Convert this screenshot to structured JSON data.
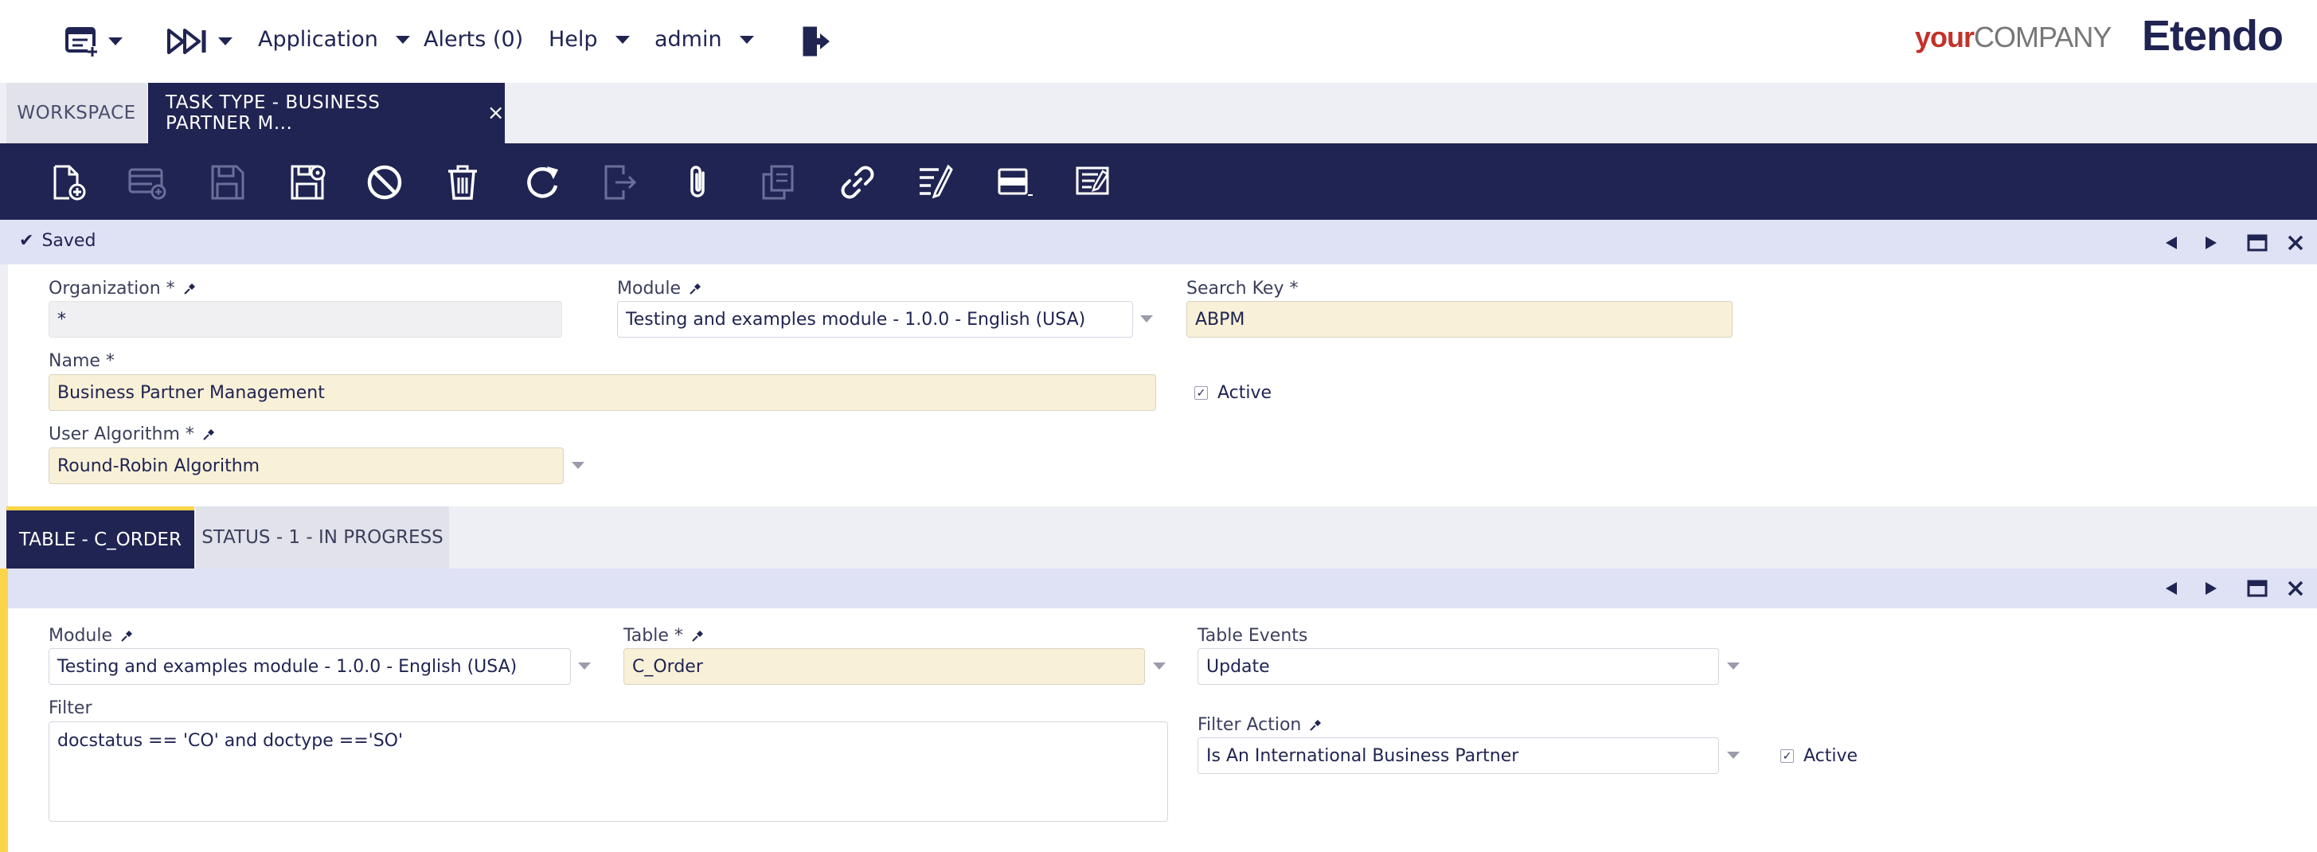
{
  "nav": {
    "application": "Application",
    "alerts": "Alerts (0)",
    "help": "Help",
    "user": "admin"
  },
  "logos": {
    "your": "your",
    "company": "COMPANY",
    "etendo": "Etendo"
  },
  "tabs": {
    "workspace": "WORKSPACE",
    "active": "TASK TYPE - BUSINESS PARTNER M...",
    "close": "×"
  },
  "toolbar": {
    "icons": [
      "new-document-icon",
      "new-row-icon",
      "save-icon",
      "save-close-icon",
      "undo-icon",
      "delete-icon",
      "refresh-icon",
      "export-icon",
      "attachment-icon",
      "clone-icon",
      "link-icon",
      "audit-icon",
      "grid-form-toggle-icon",
      "notes-icon"
    ]
  },
  "status": {
    "message": "Saved"
  },
  "header_form": {
    "organization_label": "Organization *",
    "organization_value": "*",
    "module_label": "Module",
    "module_value": "Testing and examples module - 1.0.0 - English (USA)",
    "search_key_label": "Search Key *",
    "search_key_value": "ABPM",
    "name_label": "Name *",
    "name_value": "Business Partner Management",
    "active_label": "Active",
    "user_algorithm_label": "User Algorithm *",
    "user_algorithm_value": "Round-Robin Algorithm"
  },
  "subtabs": {
    "active": "TABLE - C_ORDER",
    "inactive": "STATUS - 1 - IN PROGRESS"
  },
  "child_form": {
    "module_label": "Module",
    "module_value": "Testing and examples module - 1.0.0 - English (USA)",
    "table_label": "Table *",
    "table_value": "C_Order",
    "table_events_label": "Table Events",
    "table_events_value": "Update",
    "filter_label": "Filter",
    "filter_value": "docstatus == 'CO' and doctype =='SO'",
    "filter_action_label": "Filter Action",
    "filter_action_value": "Is An International Business Partner",
    "active_label": "Active"
  },
  "colors": {
    "navy": "#202452",
    "required_bg": "#f8f1d8",
    "status_bg": "#dfe1f5",
    "accent_yellow": "#fad54a"
  }
}
